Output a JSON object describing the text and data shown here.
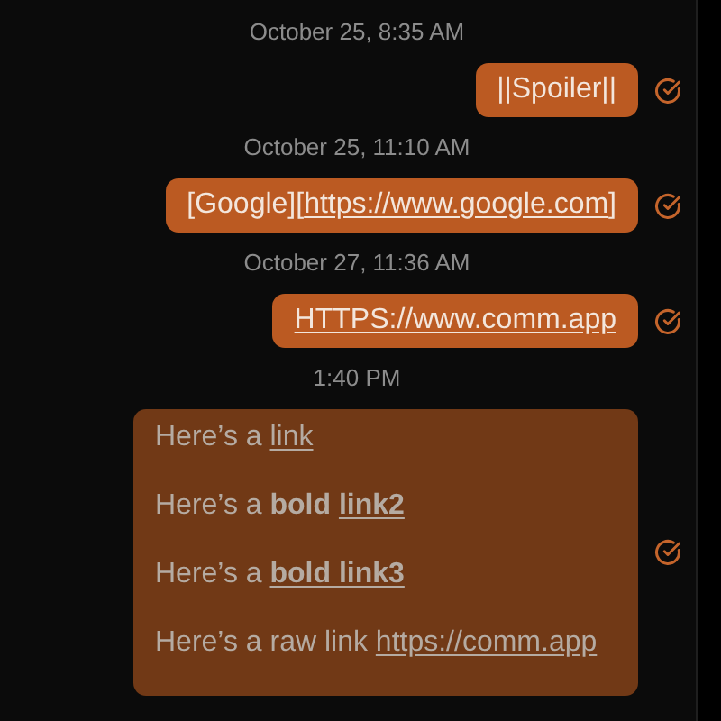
{
  "messages": [
    {
      "timestamp": "October 25, 8:35 AM",
      "kind": "plain",
      "segments": [
        {
          "text": "||Spoiler||",
          "kind": "text"
        }
      ]
    },
    {
      "timestamp": "October 25, 11:10 AM",
      "kind": "plain",
      "segments": [
        {
          "text": "[Google][",
          "kind": "text"
        },
        {
          "text": "https://www.google.com",
          "kind": "link"
        },
        {
          "text": "]",
          "kind": "text"
        }
      ]
    },
    {
      "timestamp": "October 27, 11:36 AM",
      "kind": "plain",
      "segments": [
        {
          "text": "HTTPS://www.comm.app",
          "kind": "link"
        }
      ]
    },
    {
      "timestamp": "1:40 PM",
      "kind": "rich",
      "paragraphs": [
        [
          {
            "text": "Here’s a",
            "kind": "text"
          },
          {
            "text": "link",
            "kind": "link"
          }
        ],
        [
          {
            "text": "Here’s a",
            "kind": "text"
          },
          {
            "text": "bold",
            "kind": "bold"
          },
          {
            "text": "link2",
            "kind": "bold_link"
          }
        ],
        [
          {
            "text": "Here’s a",
            "kind": "text"
          },
          {
            "text": "bold link3",
            "kind": "bold_link"
          }
        ],
        [
          {
            "text": "Here’s a raw link",
            "kind": "text"
          },
          {
            "text": "https://comm.app",
            "kind": "link"
          }
        ]
      ]
    }
  ]
}
